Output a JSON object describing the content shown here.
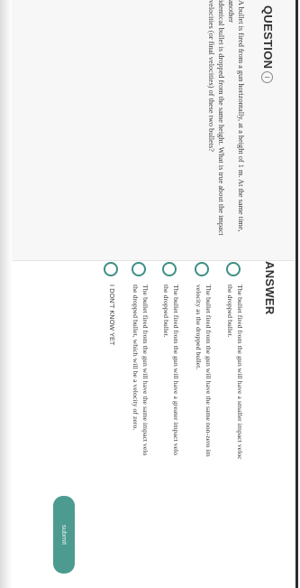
{
  "question": {
    "heading": "QUESTION",
    "info_glyph": "i",
    "info_icon": "info-icon",
    "lines": [
      "A bullet is fired from a gun horizontally, at a height of 1 m. At the same time, another",
      "identical bullet is dropped from the same height. What is true about the impact",
      "velocities (or final velocities) of these two bullets?"
    ]
  },
  "answer": {
    "heading": "ANSWER",
    "options": [
      {
        "lines": [
          "The bullet fired from the gun will have a smaller impact veloc",
          "the dropped bullet."
        ]
      },
      {
        "lines": [
          "The bullet fired from the gun will have the same non-zero im",
          "velocity as the dropped bullet."
        ]
      },
      {
        "lines": [
          "The bullet fired from the gun will have a greater impact velo",
          "the dropped bullet."
        ]
      },
      {
        "lines": [
          "The bullet fired from the gun will have the same impact velo",
          "the dropped bullet, which will be a velocity of zero."
        ]
      },
      {
        "lines": [
          "I DON'T KNOW YET"
        ]
      }
    ],
    "submit_label": "submit"
  },
  "colors": {
    "accent": "#3d8f84",
    "submit_bg": "#4d9b90"
  }
}
